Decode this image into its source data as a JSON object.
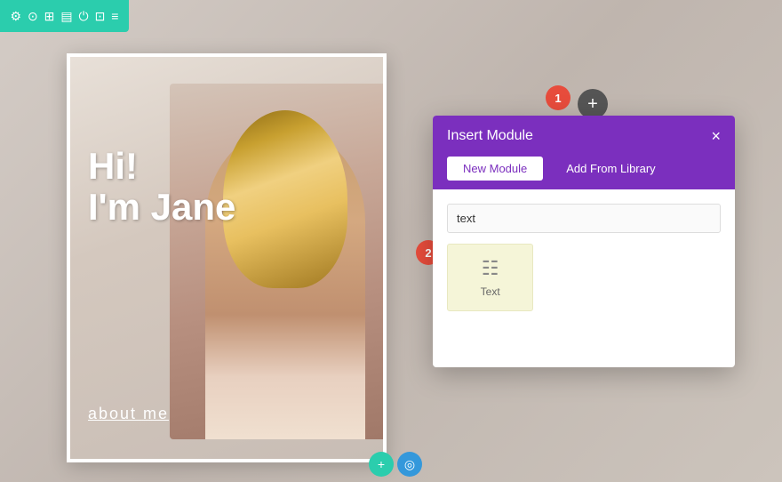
{
  "toolbar": {
    "icons": [
      "⚙",
      "⊙",
      "⊞",
      "▤",
      "⏻",
      "⊡",
      "≡"
    ]
  },
  "card": {
    "hi_text": "Hi!",
    "name_text": "I'm Jane",
    "about_text": "about me"
  },
  "badges": {
    "badge1_label": "1",
    "badge2_label": "2"
  },
  "plus_btn": {
    "label": "+"
  },
  "modal": {
    "title": "Insert Module",
    "close_label": "×",
    "tabs": [
      {
        "label": "New Module",
        "active": true
      },
      {
        "label": "Add From Library",
        "active": false
      }
    ],
    "search_placeholder": "text",
    "search_value": "text",
    "modules": [
      {
        "icon": "≡",
        "label": "Text"
      }
    ]
  },
  "bottom_btns": [
    {
      "label": "+"
    },
    {
      "label": "◎"
    }
  ]
}
